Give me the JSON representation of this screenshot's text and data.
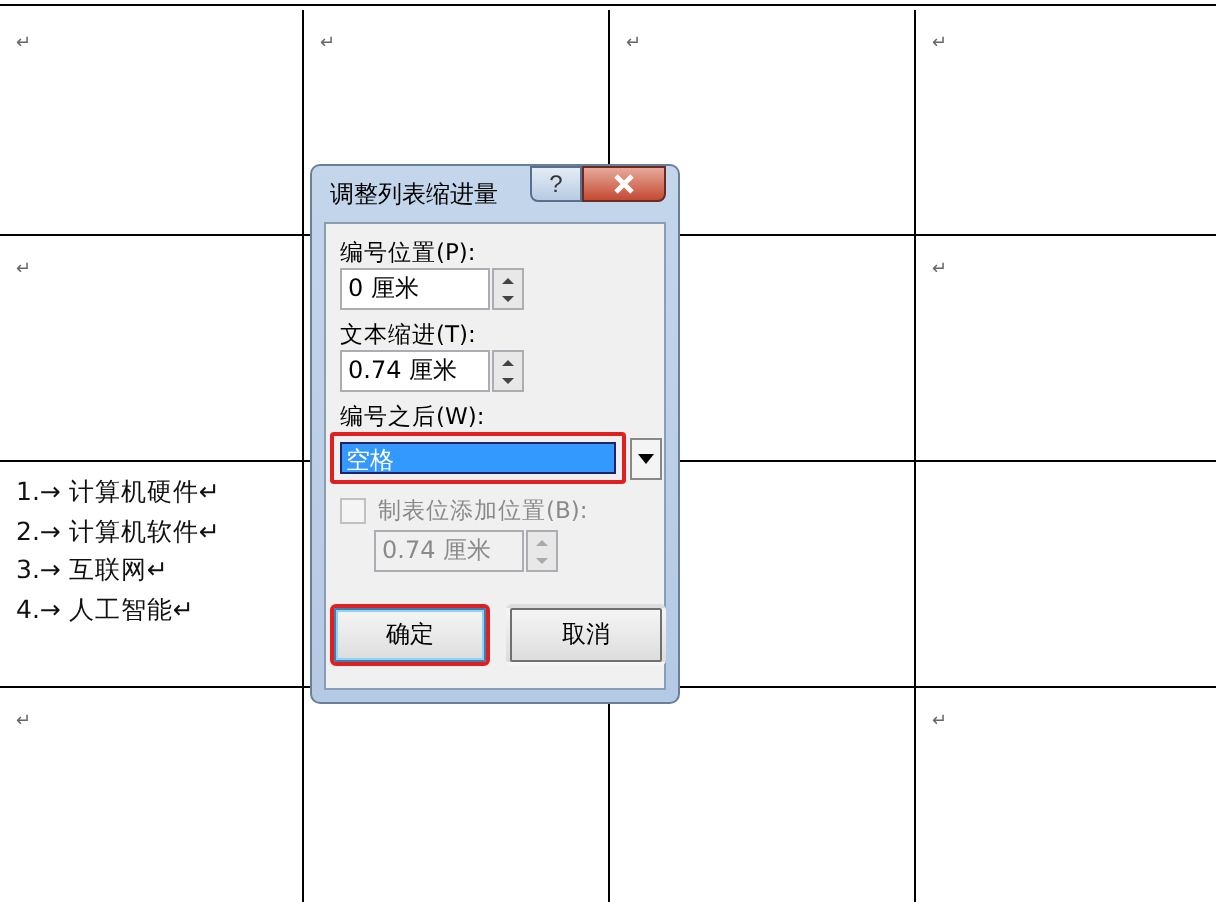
{
  "table": {
    "rows": [
      {
        "cells": [
          {
            "mark": "↵"
          },
          {
            "mark": "↵"
          },
          {
            "mark": "↵"
          },
          {
            "mark": "↵"
          }
        ]
      },
      {
        "cells": [
          {
            "mark": "↵"
          },
          {},
          {},
          {
            "mark": "↵"
          }
        ]
      },
      {
        "cells": [
          {
            "list": [
              "1.→ 计算机硬件↵",
              "2.→ 计算机软件↵",
              "3.→ 互联网↵",
              "4.→ 人工智能↵"
            ]
          },
          {},
          {},
          {}
        ]
      },
      {
        "cells": [
          {
            "mark": "↵"
          },
          {},
          {},
          {
            "mark": "↵"
          }
        ]
      }
    ]
  },
  "dialog": {
    "title": "调整列表缩进量",
    "help": "?",
    "number_position": {
      "label": "编号位置(P):",
      "value": "0 厘米"
    },
    "text_indent": {
      "label": "文本缩进(T):",
      "value": "0.74 厘米"
    },
    "follow_number": {
      "label": "编号之后(W):",
      "value": "空格",
      "selected": true,
      "highlighted": true
    },
    "tab_stop": {
      "label": "制表位添加位置(B):",
      "checked": false,
      "disabled": true,
      "value": "0.74 厘米"
    },
    "buttons": [
      {
        "label": "确定",
        "default": true,
        "highlighted": true
      },
      {
        "label": "取消",
        "default": false,
        "highlighted": false
      }
    ]
  }
}
